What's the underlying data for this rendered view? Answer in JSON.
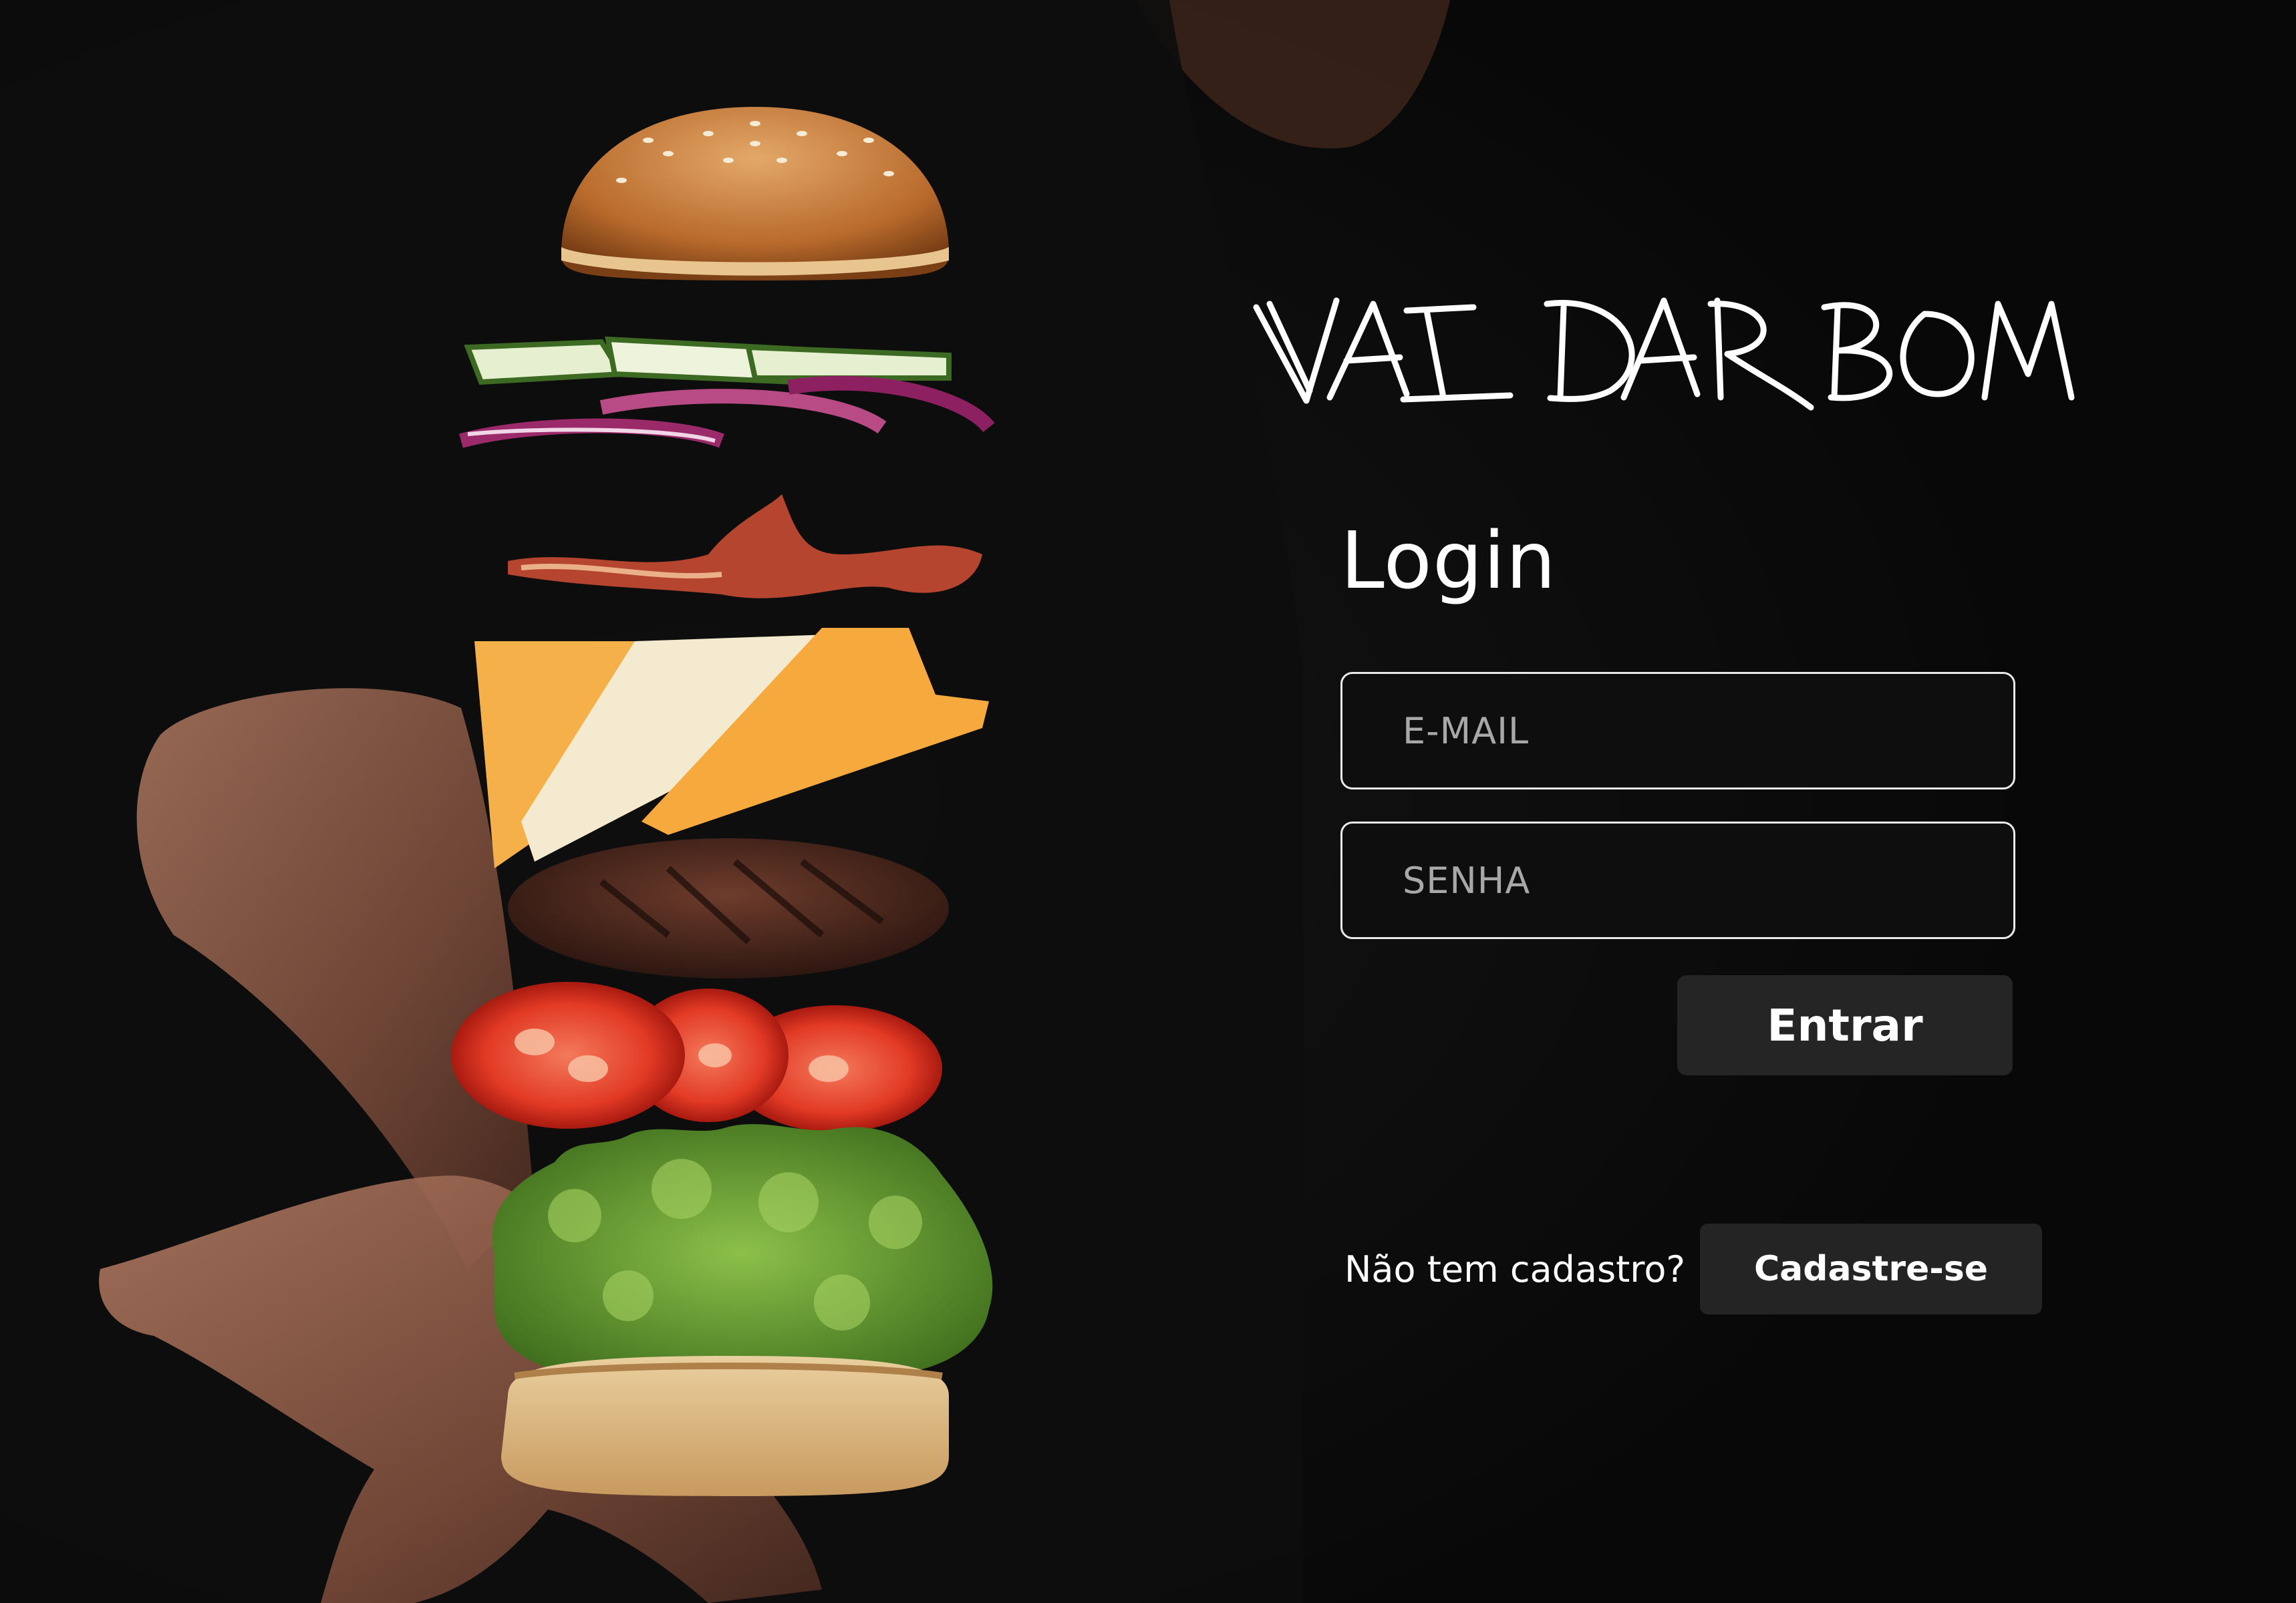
{
  "brand": {
    "logo_text": "VAI DAR BOM"
  },
  "login": {
    "title": "Login",
    "email_placeholder": "E-MAIL",
    "password_placeholder": "SENHA",
    "submit_label": "Entrar"
  },
  "signup": {
    "prompt": "Não tem cadastro?",
    "button_label": "Cadastre-se"
  },
  "theme": {
    "background": "#0b0b0b",
    "button_bg": "#252525",
    "field_border": "#e9e9e9",
    "text": "#ffffff",
    "placeholder": "#a8a8a8"
  }
}
